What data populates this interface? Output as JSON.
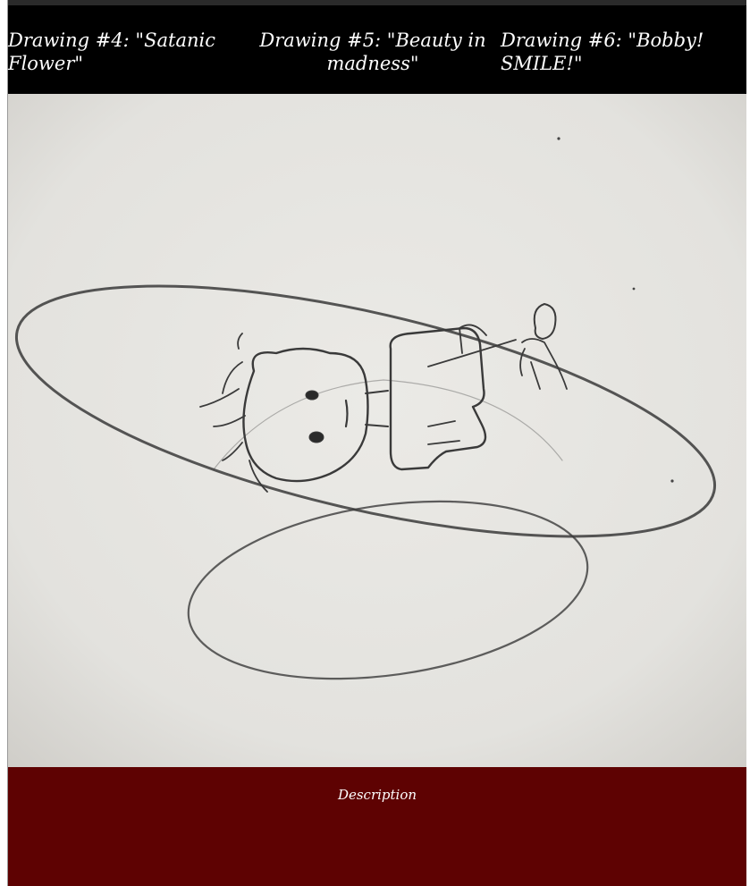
{
  "tabs": [
    {
      "label": "Drawing #4: \"Satanic Flower\""
    },
    {
      "label": "Drawing #5: \"Beauty in madness\""
    },
    {
      "label": "Drawing #6: \"Bobby! SMILE!\""
    }
  ],
  "description": {
    "heading": "Description"
  },
  "colors": {
    "tab_bar": "#000000",
    "description_panel": "#5e0202",
    "paper": "#e6e5e1",
    "pencil": "#3a3a3a"
  }
}
